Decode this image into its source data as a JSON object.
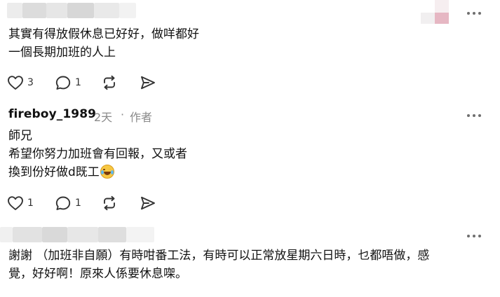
{
  "comment1": {
    "lines": [
      "其實有得放假休息已好好，做咩都好",
      "一個長期加班的人上"
    ],
    "likes": "3",
    "replies": "1"
  },
  "comment2": {
    "username": "fireboy_1989",
    "time": "2天",
    "separator": "·",
    "role": "作者",
    "lines": [
      "師兄",
      "希望你努力加班會有回報，又或者",
      "換到份好做d既工"
    ],
    "emoji": "joy-emoji",
    "likes": "1",
    "replies": "1"
  },
  "comment3": {
    "lines": [
      "謝謝 （加班非自願）有時咁番工法，有時可以正常放星期六日時，乜都唔做，感",
      "覺，好好啊！原來人係要休息㗎。"
    ]
  },
  "icons": [
    "heart-icon",
    "comment-icon",
    "repost-icon",
    "share-icon",
    "more-icon"
  ],
  "colors": {
    "text": "#111111",
    "meta": "#8a8a8a",
    "icon": "#333333"
  }
}
